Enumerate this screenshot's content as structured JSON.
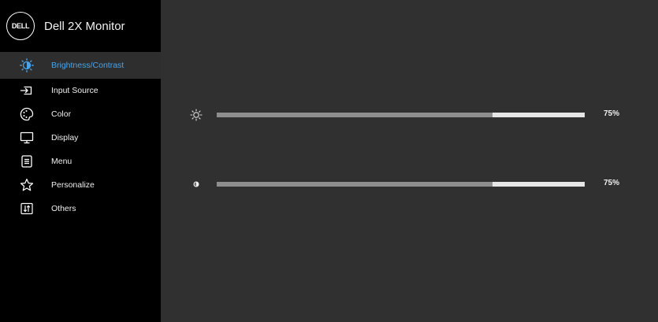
{
  "header": {
    "logo_text": "DELL",
    "model": "Dell 2X Monitor"
  },
  "menu": [
    {
      "label": "Brightness/Contrast",
      "icon": "brightness-icon",
      "active": true
    },
    {
      "label": "Input Source",
      "icon": "input-source-icon",
      "active": false
    },
    {
      "label": "Color",
      "icon": "palette-icon",
      "active": false
    },
    {
      "label": "Display",
      "icon": "monitor-icon",
      "active": false
    },
    {
      "label": "Menu",
      "icon": "menu-list-icon",
      "active": false
    },
    {
      "label": "Personalize",
      "icon": "star-icon",
      "active": false
    },
    {
      "label": "Others",
      "icon": "others-icon",
      "active": false
    }
  ],
  "sliders": {
    "brightness": {
      "value": 75,
      "label": "75%",
      "icon": "sun-icon"
    },
    "contrast": {
      "value": 75,
      "label": "75%",
      "icon": "contrast-icon"
    }
  },
  "colors": {
    "accent": "#4aa3e8",
    "sidebar_bg": "#000000",
    "active_bg": "#2e2e2e",
    "content_bg": "#303030",
    "track_fill": "#8e8e8e",
    "track_bg": "#e6e6e6"
  }
}
